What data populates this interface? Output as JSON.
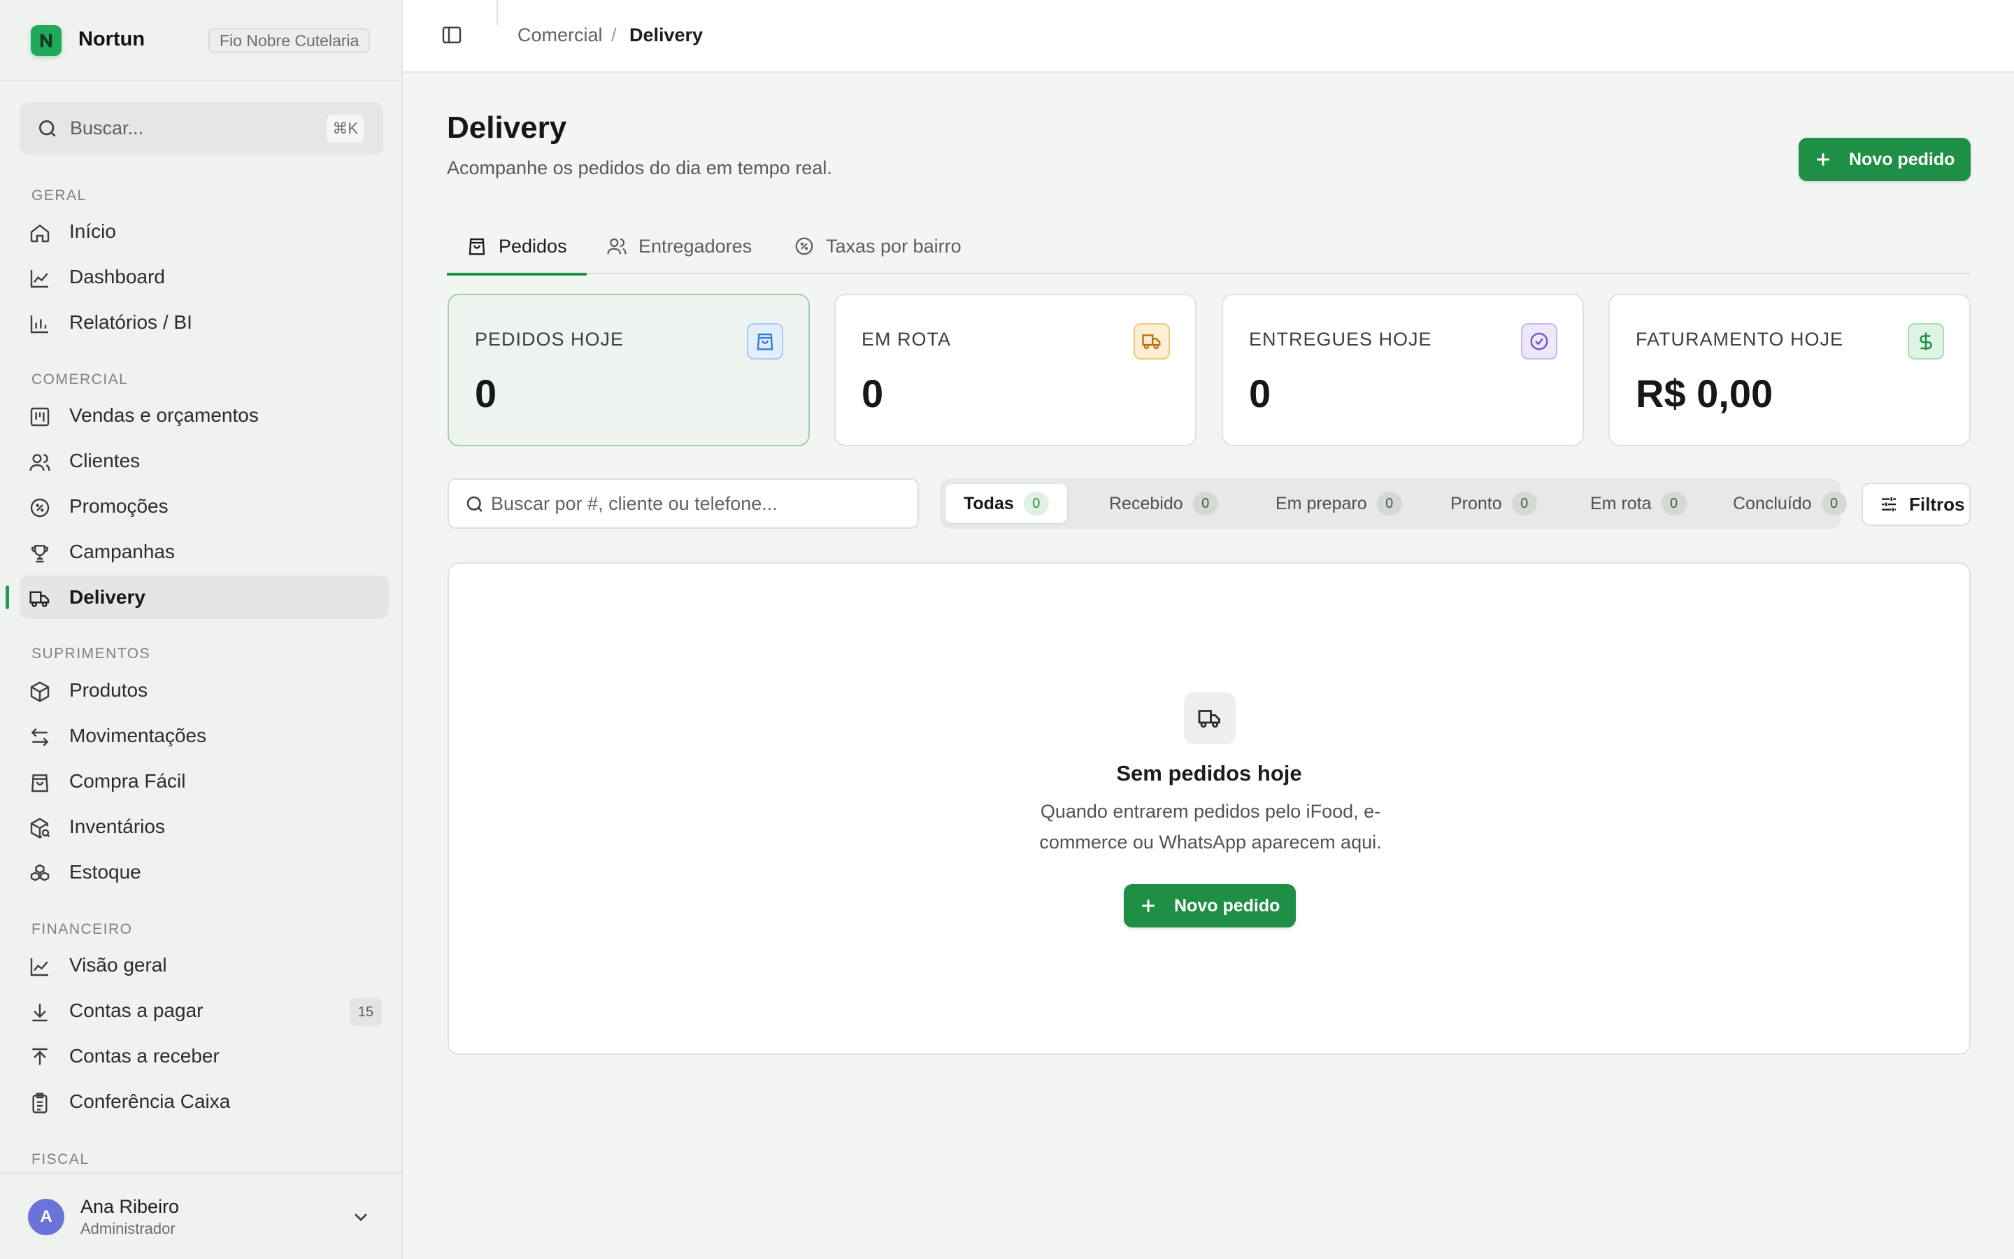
{
  "app": {
    "name": "Nortun",
    "company": "Fio Nobre Cutelaria"
  },
  "sidebar": {
    "search": {
      "placeholder": "Buscar...",
      "shortcut": "⌘K"
    },
    "sections": [
      {
        "title": "GERAL",
        "items": [
          {
            "label": "Início",
            "icon": "home-icon"
          },
          {
            "label": "Dashboard",
            "icon": "line-chart-icon"
          },
          {
            "label": "Relatórios / BI",
            "icon": "bar-chart-icon"
          }
        ]
      },
      {
        "title": "COMERCIAL",
        "items": [
          {
            "label": "Vendas e orçamentos",
            "icon": "kanban-icon"
          },
          {
            "label": "Clientes",
            "icon": "users-icon"
          },
          {
            "label": "Promoções",
            "icon": "percent-badge-icon"
          },
          {
            "label": "Campanhas",
            "icon": "trophy-icon"
          },
          {
            "label": "Delivery",
            "icon": "truck-icon",
            "active": true
          }
        ]
      },
      {
        "title": "SUPRIMENTOS",
        "items": [
          {
            "label": "Produtos",
            "icon": "package-icon"
          },
          {
            "label": "Movimentações",
            "icon": "arrows-left-right-icon"
          },
          {
            "label": "Compra Fácil",
            "icon": "shopping-bag-icon"
          },
          {
            "label": "Inventários",
            "icon": "package-search-icon"
          },
          {
            "label": "Estoque",
            "icon": "boxes-icon"
          }
        ]
      },
      {
        "title": "FINANCEIRO",
        "items": [
          {
            "label": "Visão geral",
            "icon": "line-chart-icon"
          },
          {
            "label": "Contas a pagar",
            "icon": "download-icon",
            "count": "15"
          },
          {
            "label": "Contas a receber",
            "icon": "upload-icon"
          },
          {
            "label": "Conferência Caixa",
            "icon": "clipboard-icon"
          }
        ]
      },
      {
        "title": "FISCAL",
        "items": []
      }
    ],
    "user": {
      "initial": "A",
      "name": "Ana Ribeiro",
      "role": "Administrador"
    }
  },
  "header": {
    "breadcrumb": {
      "parent": "Comercial",
      "separator": "/",
      "current": "Delivery"
    }
  },
  "page": {
    "title": "Delivery",
    "subtitle": "Acompanhe os pedidos do dia em tempo real.",
    "new_order_label": "Novo pedido",
    "tabs": [
      {
        "label": "Pedidos",
        "icon": "shopping-bag-icon",
        "active": true
      },
      {
        "label": "Entregadores",
        "icon": "users-icon"
      },
      {
        "label": "Taxas por bairro",
        "icon": "percent-badge-icon"
      }
    ],
    "stats": [
      {
        "label": "PEDIDOS HOJE",
        "value": "0",
        "icon": "shopping-bag-icon",
        "color": "#2f7fd8"
      },
      {
        "label": "EM ROTA",
        "value": "0",
        "icon": "truck-icon",
        "color": "#d98a12"
      },
      {
        "label": "ENTREGUES HOJE",
        "value": "0",
        "icon": "check-circle-icon",
        "color": "#7a4fd0"
      },
      {
        "label": "FATURAMENTO HOJE",
        "value": "R$ 0,00",
        "icon": "dollar-icon",
        "color": "#1e8f44"
      }
    ],
    "order_search": {
      "placeholder": "Buscar por #, cliente ou telefone..."
    },
    "status_filters": [
      {
        "label": "Todas",
        "count": "0",
        "active": true
      },
      {
        "label": "Recebido",
        "count": "0"
      },
      {
        "label": "Em preparo",
        "count": "0"
      },
      {
        "label": "Pronto",
        "count": "0"
      },
      {
        "label": "Em rota",
        "count": "0"
      },
      {
        "label": "Concluído",
        "count": "0"
      }
    ],
    "filters_label": "Filtros",
    "empty": {
      "title": "Sem pedidos hoje",
      "description": "Quando entrarem pedidos pelo iFood, e-commerce ou WhatsApp aparecem aqui.",
      "button_label": "Novo pedido"
    }
  },
  "colors": {
    "accent": "#1e8f44",
    "brand": "#22a85a"
  }
}
